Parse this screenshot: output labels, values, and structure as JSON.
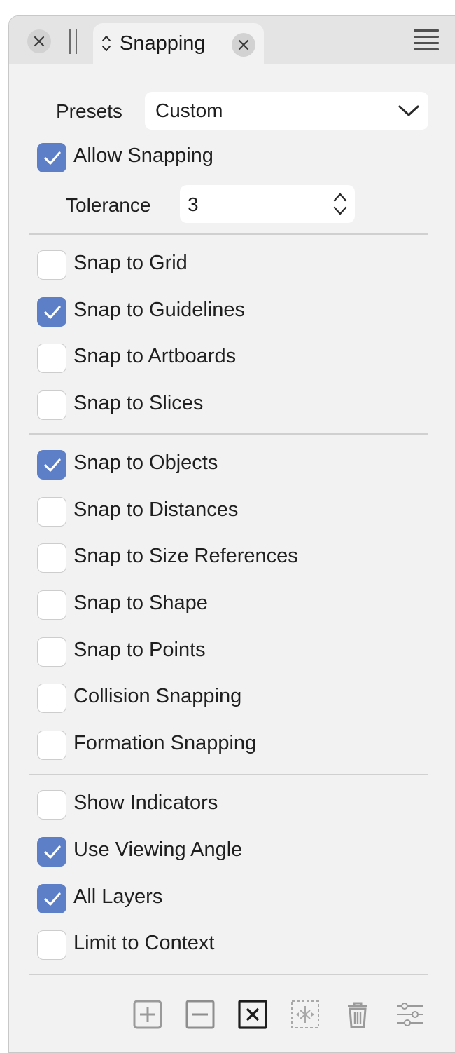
{
  "tab": {
    "title": "Snapping"
  },
  "presets": {
    "label": "Presets",
    "value": "Custom"
  },
  "allow_snapping": {
    "label": "Allow Snapping",
    "checked": true
  },
  "tolerance": {
    "label": "Tolerance",
    "value": "3"
  },
  "group1": [
    {
      "label": "Snap to Grid",
      "checked": false
    },
    {
      "label": "Snap to Guidelines",
      "checked": true
    },
    {
      "label": "Snap to Artboards",
      "checked": false
    },
    {
      "label": "Snap to Slices",
      "checked": false
    }
  ],
  "group2": [
    {
      "label": "Snap to Objects",
      "checked": true
    },
    {
      "label": "Snap to Distances",
      "checked": false
    },
    {
      "label": "Snap to Size References",
      "checked": false
    },
    {
      "label": "Snap to Shape",
      "checked": false
    },
    {
      "label": "Snap to Points",
      "checked": false
    },
    {
      "label": "Collision Snapping",
      "checked": false
    },
    {
      "label": "Formation Snapping",
      "checked": false
    }
  ],
  "group3": [
    {
      "label": "Show Indicators",
      "checked": false
    },
    {
      "label": "Use Viewing Angle",
      "checked": true
    },
    {
      "label": "All Layers",
      "checked": true
    },
    {
      "label": "Limit to Context",
      "checked": false
    }
  ],
  "toolbar": {
    "icons": [
      "add-icon",
      "remove-icon",
      "clear-icon",
      "center-icon",
      "trash-icon",
      "settings-sliders-icon"
    ]
  },
  "colors": {
    "accent": "#5d7fc7",
    "panel_bg": "#f2f2f2",
    "tabbar_bg": "#e4e4e4"
  }
}
